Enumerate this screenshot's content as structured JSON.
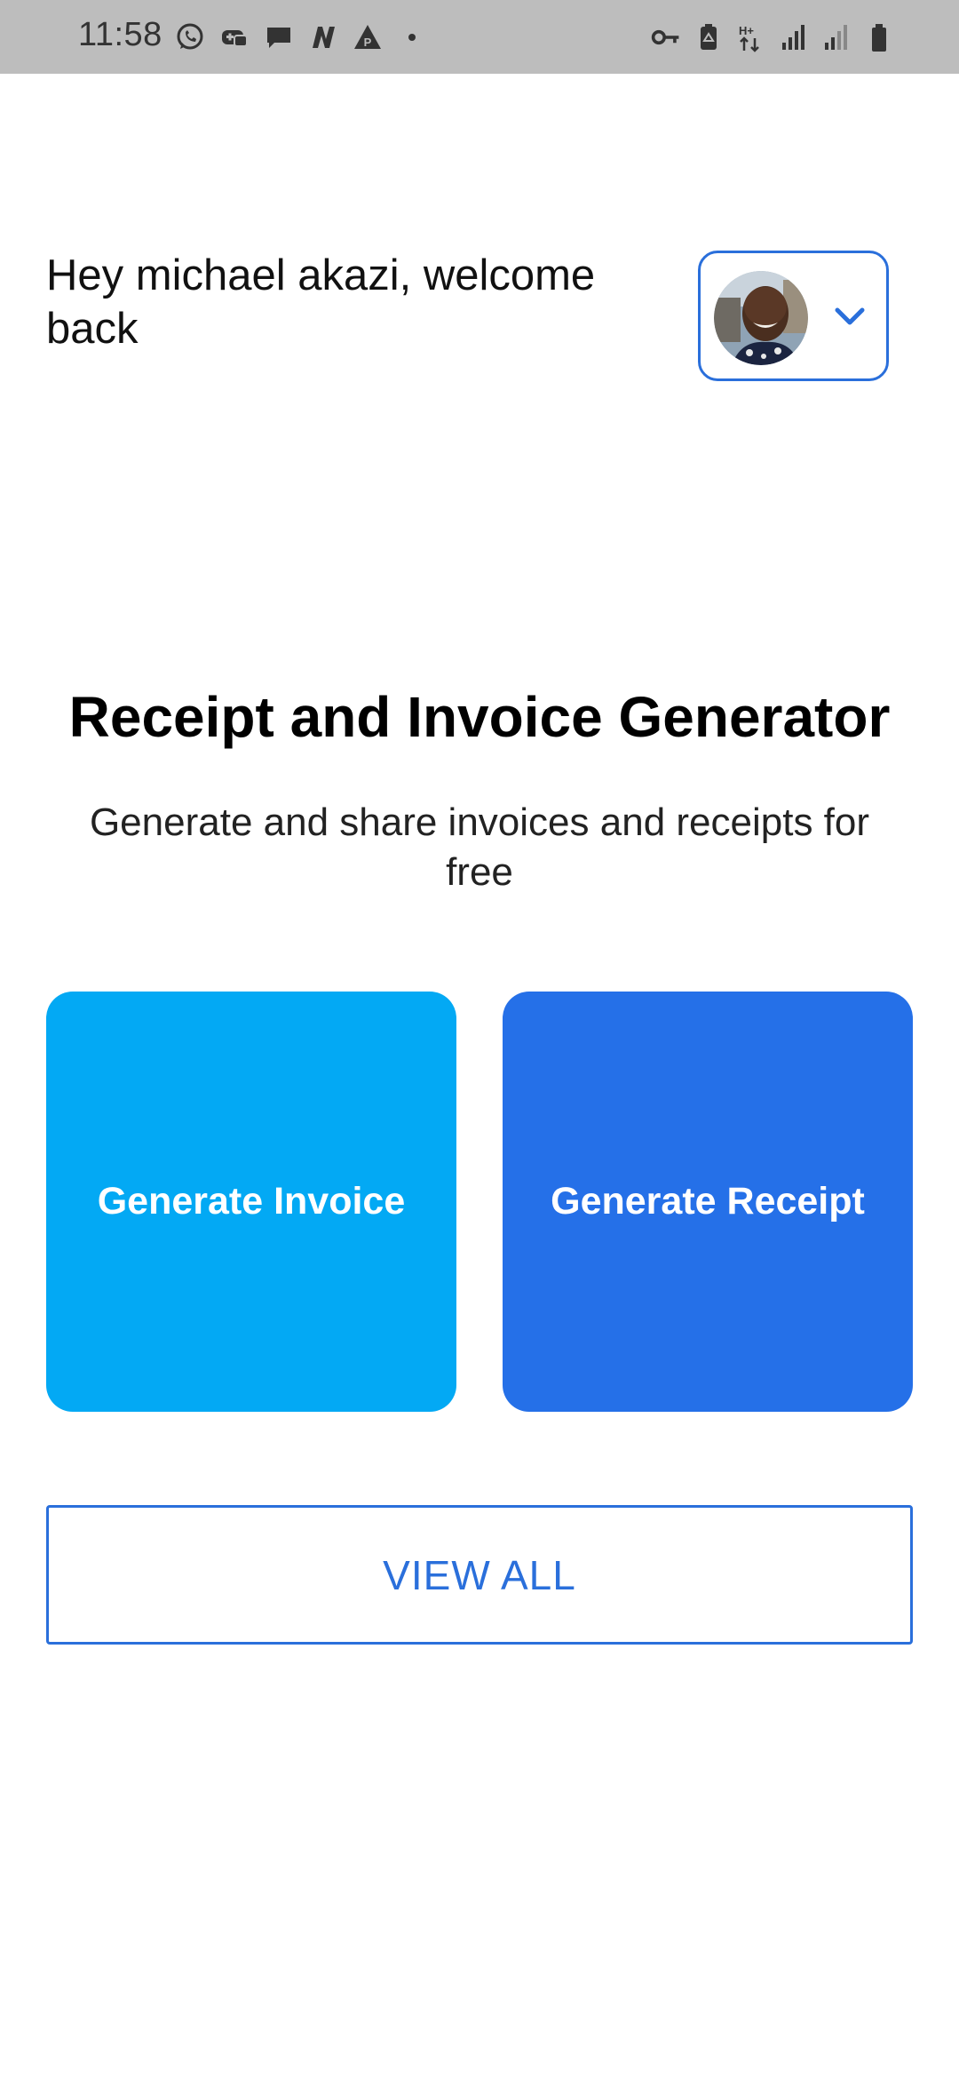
{
  "status_bar": {
    "time": "11:58",
    "left_icons": [
      "whatsapp-icon",
      "game-controller-icon",
      "message-icon",
      "n-app-icon",
      "warning-p-icon",
      "dot-icon"
    ],
    "right_icons": [
      "vpn-key-icon",
      "battery-saver-icon",
      "data-hplus-icon",
      "signal-1-icon",
      "signal-2-icon",
      "battery-icon"
    ],
    "data_indicator": "H+"
  },
  "header": {
    "greeting": "Hey michael akazi, welcome back",
    "profile_avatar": "avatar",
    "dropdown_icon": "chevron-down-icon"
  },
  "main": {
    "title": "Receipt and Invoice Generator",
    "subtitle": "Generate and share invoices and receipts for free",
    "invoice_button": "Generate Invoice",
    "receipt_button": "Generate Receipt",
    "view_all_button": "VIEW ALL"
  },
  "colors": {
    "accent_blue": "#2a6fdb",
    "invoice_card": "#03a9f4",
    "receipt_card": "#2570e8",
    "status_bar_bg": "#bdbdbd"
  }
}
